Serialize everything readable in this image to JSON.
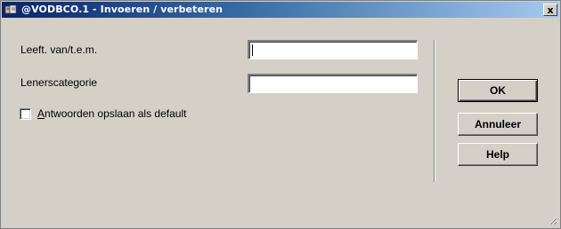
{
  "window": {
    "title": "@VODBCO.1 - Invoeren / verbeteren",
    "close_label": "x"
  },
  "form": {
    "age_label": "Leeft. van/t.e.m.",
    "age_value": "",
    "category_label": "Lenerscategorie",
    "category_value": "",
    "default_checkbox": {
      "mnemonic": "A",
      "label_rest": "ntwoorden opslaan als default",
      "checked": false
    }
  },
  "buttons": {
    "ok": {
      "mnemonic": "O",
      "rest": "K"
    },
    "cancel": {
      "mnemonic": "A",
      "rest": "nnuleer"
    },
    "help": {
      "mnemonic": "H",
      "rest": "elp"
    }
  },
  "icons": {
    "app": "app-icon",
    "close": "close-icon",
    "resize": "resize-grip-icon"
  },
  "colors": {
    "titlebar_start": "#0a246a",
    "titlebar_end": "#a6caf0",
    "face": "#d4d0c8"
  }
}
